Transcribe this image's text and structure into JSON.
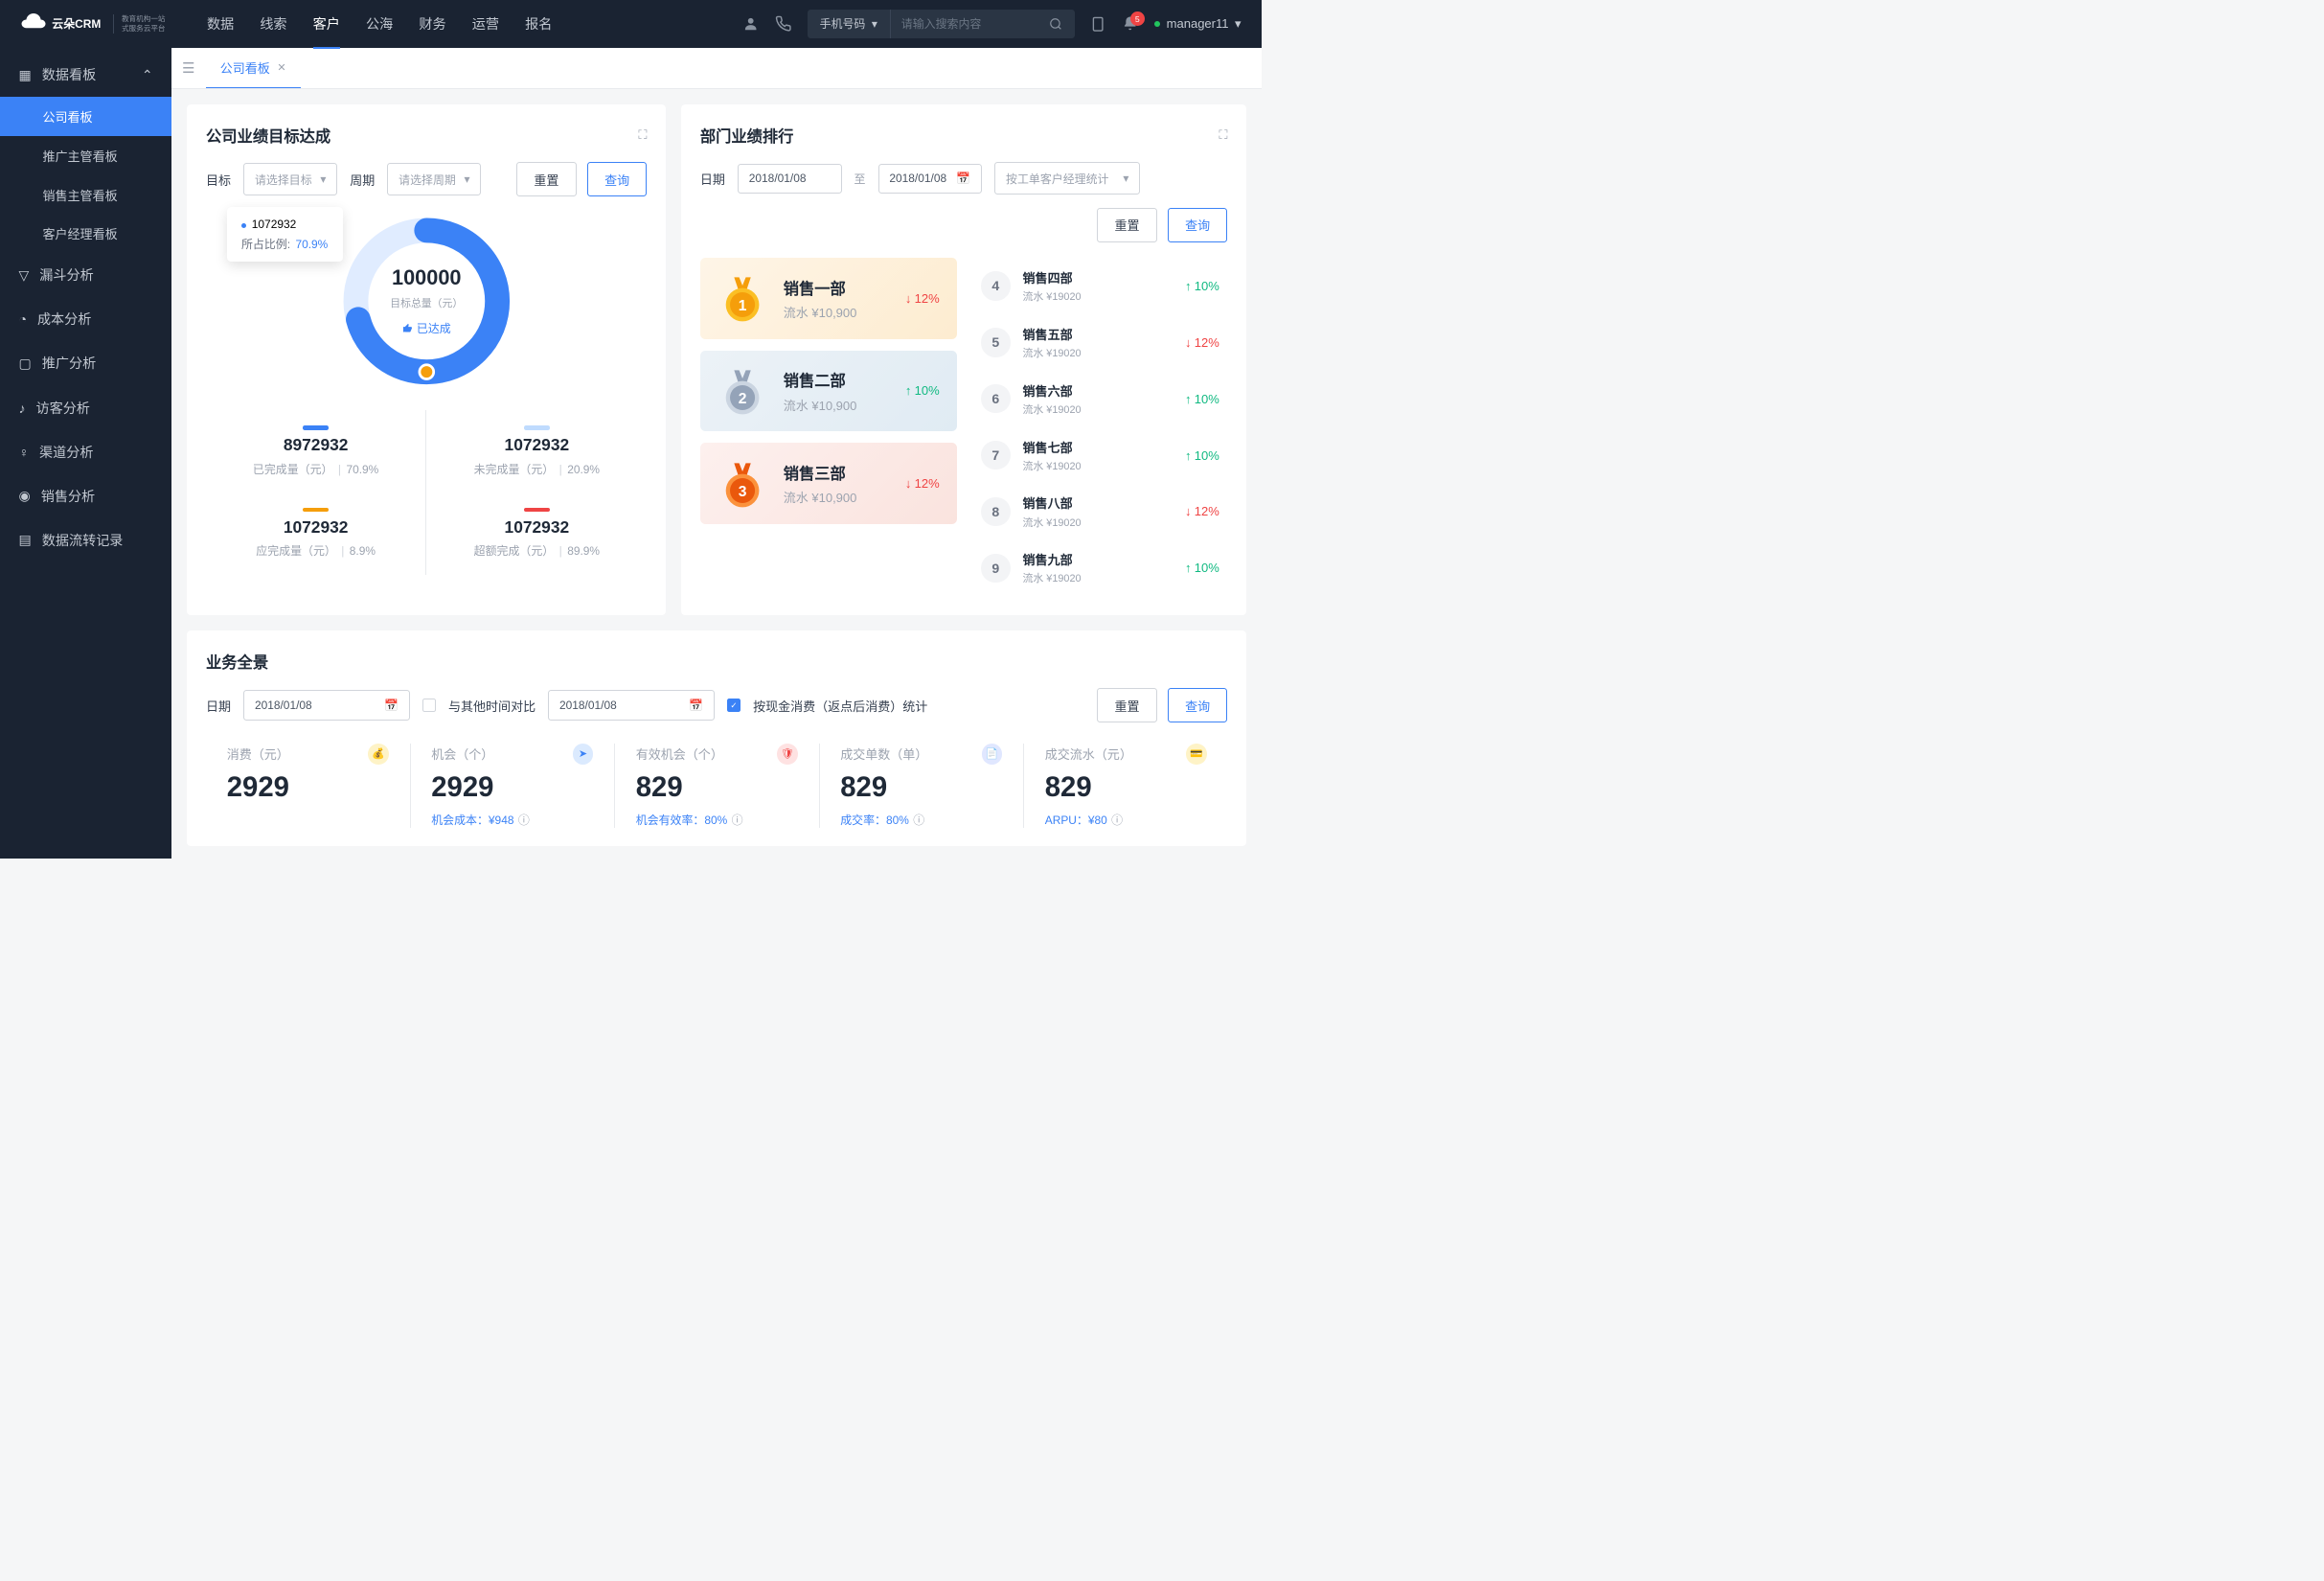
{
  "brand": {
    "name": "云朵CRM",
    "sub1": "教育机构一站",
    "sub2": "式服务云平台"
  },
  "nav": [
    {
      "label": "数据"
    },
    {
      "label": "线索"
    },
    {
      "label": "客户",
      "active": true
    },
    {
      "label": "公海"
    },
    {
      "label": "财务"
    },
    {
      "label": "运营"
    },
    {
      "label": "报名"
    }
  ],
  "search": {
    "type": "手机号码",
    "placeholder": "请输入搜索内容"
  },
  "notif": {
    "count": "5"
  },
  "user": {
    "name": "manager11"
  },
  "sidebar": [
    {
      "label": "数据看板",
      "expanded": true,
      "children": [
        {
          "label": "公司看板",
          "active": true
        },
        {
          "label": "推广主管看板"
        },
        {
          "label": "销售主管看板"
        },
        {
          "label": "客户经理看板"
        }
      ]
    },
    {
      "label": "漏斗分析"
    },
    {
      "label": "成本分析"
    },
    {
      "label": "推广分析"
    },
    {
      "label": "访客分析"
    },
    {
      "label": "渠道分析"
    },
    {
      "label": "销售分析"
    },
    {
      "label": "数据流转记录"
    }
  ],
  "tab": {
    "label": "公司看板"
  },
  "panel1": {
    "title": "公司业绩目标达成",
    "filters": {
      "target_label": "目标",
      "target_ph": "请选择目标",
      "period_label": "周期",
      "period_ph": "请选择周期",
      "reset": "重置",
      "query": "查询"
    },
    "tooltip": {
      "val": "1072932",
      "label": "所占比例:",
      "pct": "70.9%"
    },
    "donut": {
      "total": "100000",
      "sublabel": "目标总量（元）",
      "badge": "已达成"
    },
    "stats": [
      {
        "color": "#3b82f6",
        "val": "8972932",
        "label": "已完成量（元）",
        "pct": "70.9%"
      },
      {
        "color": "#bfdbfe",
        "val": "1072932",
        "label": "未完成量（元）",
        "pct": "20.9%"
      },
      {
        "color": "#f59e0b",
        "val": "1072932",
        "label": "应完成量（元）",
        "pct": "8.9%"
      },
      {
        "color": "#ef4444",
        "val": "1072932",
        "label": "超额完成（元）",
        "pct": "89.9%"
      }
    ]
  },
  "panel2": {
    "title": "部门业绩排行",
    "filters": {
      "date_label": "日期",
      "date1": "2018/01/08",
      "to": "至",
      "date2": "2018/01/08",
      "mode": "按工单客户经理统计",
      "reset": "重置",
      "query": "查询"
    },
    "top3": [
      {
        "name": "销售一部",
        "sub": "流水 ¥10,900",
        "pct": "12%",
        "dir": "down",
        "class": "gold"
      },
      {
        "name": "销售二部",
        "sub": "流水 ¥10,900",
        "pct": "10%",
        "dir": "up",
        "class": "silver"
      },
      {
        "name": "销售三部",
        "sub": "流水 ¥10,900",
        "pct": "12%",
        "dir": "down",
        "class": "bronze"
      }
    ],
    "rest": [
      {
        "n": "4",
        "name": "销售四部",
        "sub": "流水 ¥19020",
        "pct": "10%",
        "dir": "up"
      },
      {
        "n": "5",
        "name": "销售五部",
        "sub": "流水 ¥19020",
        "pct": "12%",
        "dir": "down"
      },
      {
        "n": "6",
        "name": "销售六部",
        "sub": "流水 ¥19020",
        "pct": "10%",
        "dir": "up"
      },
      {
        "n": "7",
        "name": "销售七部",
        "sub": "流水 ¥19020",
        "pct": "10%",
        "dir": "up"
      },
      {
        "n": "8",
        "name": "销售八部",
        "sub": "流水 ¥19020",
        "pct": "12%",
        "dir": "down"
      },
      {
        "n": "9",
        "name": "销售九部",
        "sub": "流水 ¥19020",
        "pct": "10%",
        "dir": "up"
      }
    ]
  },
  "panel3": {
    "title": "业务全景",
    "filters": {
      "date_label": "日期",
      "date1": "2018/01/08",
      "compare": "与其他时间对比",
      "date2": "2018/01/08",
      "stat": "按现金消费（返点后消费）统计",
      "reset": "重置",
      "query": "查询"
    },
    "metrics": [
      {
        "label": "消费（元）",
        "val": "2929",
        "icon": "money",
        "bg": "#fef3c7",
        "color": "#f59e0b"
      },
      {
        "label": "机会（个）",
        "val": "2929",
        "foot": "机会成本：¥948",
        "icon": "send",
        "bg": "#dbeafe",
        "color": "#3b82f6"
      },
      {
        "label": "有效机会（个）",
        "val": "829",
        "foot": "机会有效率：80%",
        "icon": "shield",
        "bg": "#fee2e2",
        "color": "#ef4444"
      },
      {
        "label": "成交单数（单）",
        "val": "829",
        "foot": "成交率：80%",
        "icon": "doc",
        "bg": "#e0e7ff",
        "color": "#6366f1"
      },
      {
        "label": "成交流水（元）",
        "val": "829",
        "foot": "ARPU：¥80",
        "icon": "card",
        "bg": "#fef3c7",
        "color": "#f59e0b"
      }
    ]
  },
  "chart_data": {
    "type": "pie",
    "title": "公司业绩目标达成",
    "total": 100000,
    "series": [
      {
        "name": "已完成量（元）",
        "value": 8972932,
        "pct": 70.9,
        "color": "#3b82f6"
      },
      {
        "name": "未完成量（元）",
        "value": 1072932,
        "pct": 20.9,
        "color": "#bfdbfe"
      },
      {
        "name": "应完成量（元）",
        "value": 1072932,
        "pct": 8.9,
        "color": "#f59e0b"
      },
      {
        "name": "超额完成（元）",
        "value": 1072932,
        "pct": 89.9,
        "color": "#ef4444"
      }
    ]
  }
}
